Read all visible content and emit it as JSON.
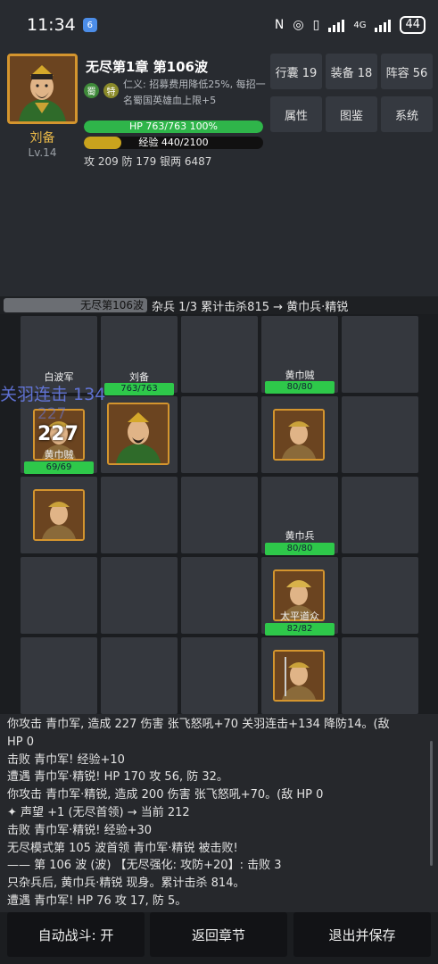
{
  "status_bar": {
    "time": "11:34",
    "battery": "44",
    "network": "4G"
  },
  "hero": {
    "name": "刘备",
    "level": "Lv.14",
    "stage_title": "无尽第1章 第106波",
    "faction_tag": "蜀",
    "special_tag": "特",
    "skill_text": "仁义: 招募费用降低25%, 每招一名蜀国英雄血上限+5",
    "hp_text": "HP 763/763 100%",
    "hp_fraction": 1.0,
    "exp_text": "经验 440/2100",
    "exp_fraction": 0.2095,
    "stats_text": "攻 209  防 179  银两 6487"
  },
  "menu": {
    "bag": "行囊 19",
    "equip": "装备 18",
    "lineup": "阵容 56",
    "attr": "属性",
    "codex": "图鉴",
    "system": "系统"
  },
  "battle": {
    "wave_pill": "无尽第106波",
    "wave_info": "杂兵 1/3  累计击杀815 → 黄巾兵·精锐"
  },
  "board": {
    "units": {
      "ally_baibo_label": "白波军",
      "ally_liubei_label": "刘备",
      "ally_liubei_hp": "763/763",
      "enemy_huangjinzei_label": "黄巾贼",
      "enemy_huangjinzei_hp": "80/80",
      "enemy_huangjinzei2_label": "黄巾贼",
      "enemy_huangjinzei2_hp": "69/69",
      "enemy_huangjinbing_label": "黄巾兵",
      "enemy_huangjinbing_hp": "80/80",
      "enemy_taiping_label": "太平道众",
      "enemy_taiping_hp": "82/82"
    },
    "float_combo": "关羽连击 134",
    "float_faint": "227",
    "damage_number": "227"
  },
  "log": [
    "你攻击 青巾军, 造成 227 伤害 张飞怒吼+70 关羽连击+134 降防14。(敌",
    "HP 0",
    "击败 青巾军! 经验+10",
    "遭遇 青巾军·精锐! HP 170 攻 56, 防 32。",
    "你攻击 青巾军·精锐, 造成 200 伤害 张飞怒吼+70。(敌 HP 0",
    "✦ 声望 +1 (无尽首领) → 当前 212",
    "击败 青巾军·精锐! 经验+30",
    "无尽模式第 105 波首领 青巾军·精锐 被击败!",
    "—— 第 106 波 (波) 【无尽强化: 攻防+20】: 击败 3",
    "只杂兵后, 黄巾兵·精锐 现身。累计击杀 814。",
    "遭遇 青巾军! HP 76 攻 17, 防 5。"
  ],
  "bottom": {
    "auto_battle": "自动战斗: 开",
    "back_chapter": "返回章节",
    "exit_save": "退出并保存"
  },
  "colors": {
    "hp": "#2fb54a",
    "exp": "#c9a31d",
    "gold": "#e9b949"
  }
}
